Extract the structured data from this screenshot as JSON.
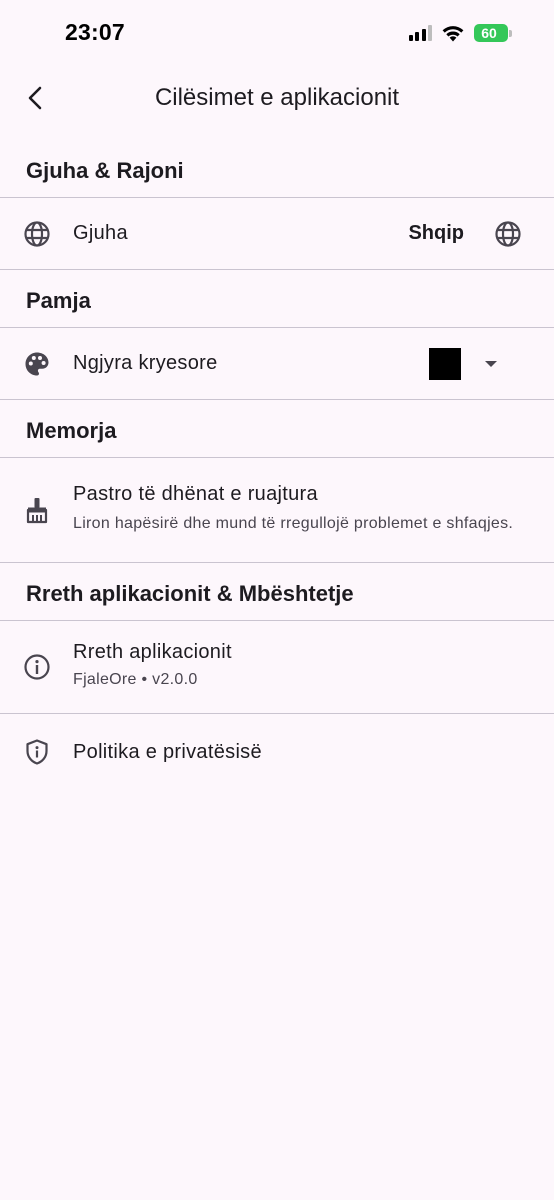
{
  "status_bar": {
    "time": "23:07",
    "battery": "60"
  },
  "app_bar": {
    "title": "Cilësimet e aplikacionit"
  },
  "sections": {
    "language": {
      "header": "Gjuha & Rajoni",
      "item_title": "Gjuha",
      "item_value": "Shqip"
    },
    "appearance": {
      "header": "Pamja",
      "item_title": "Ngjyra kryesore",
      "swatch_color": "#000000"
    },
    "storage": {
      "header": "Memorja",
      "item_title": "Pastro të dhënat e ruajtura",
      "item_subtitle": "Liron hapësirë dhe mund të rregullojë problemet e shfaqjes."
    },
    "about": {
      "header": "Rreth aplikacionit & Mbështetje",
      "about_title": "Rreth aplikacionit",
      "about_subtitle": "FjaleOre • v2.0.0",
      "privacy_title": "Politika e privatësisë"
    }
  },
  "icons": {
    "back": "arrow-back-icon",
    "language": "globe-icon",
    "color": "palette-icon",
    "storage": "broom-icon",
    "about": "info-icon",
    "privacy": "shield-icon"
  },
  "colors": {
    "background": "#fdf7fc",
    "divider": "#cac4d0",
    "battery": "#34c759"
  }
}
